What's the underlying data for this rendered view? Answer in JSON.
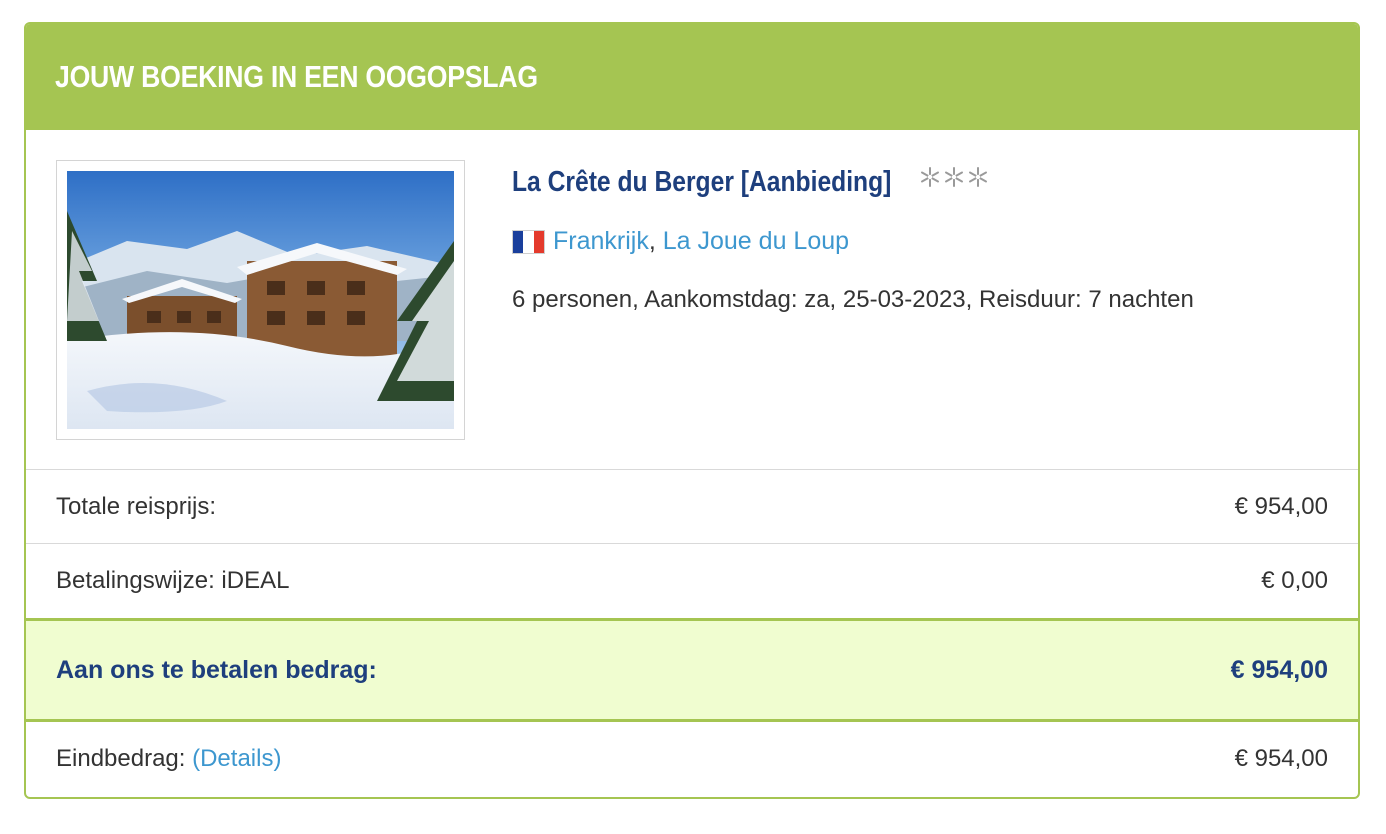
{
  "header": {
    "title": "JOUW BOEKING IN EEN OOGOPSLAG"
  },
  "accommodation": {
    "name": "La Crête du Berger [Aanbieding]",
    "star_count": 3,
    "country": "Frankrijk",
    "separator": ",",
    "place": "La Joue du Loup",
    "details": "6 personen, Aankomstdag: za, 25-03-2023, Reisduur: 7 nachten",
    "flag_colors": [
      "#1a3f9c",
      "#ffffff",
      "#e43a2c"
    ],
    "photo_icon": "snowy-chalet-photo"
  },
  "rows": {
    "total": {
      "label": "Totale reisprijs:",
      "value": "€ 954,00"
    },
    "payment": {
      "label": "Betalingswijze: iDEAL",
      "value": "€ 0,00"
    },
    "due": {
      "label": "Aan ons te betalen bedrag:",
      "value": "€ 954,00"
    },
    "final": {
      "label": "Eindbedrag:",
      "link": "(Details)",
      "value": "€ 954,00"
    }
  },
  "colors": {
    "accent": "#a5c552",
    "highlight_bg": "#f0fdd0",
    "title_blue": "#1e3f7d",
    "link_blue": "#3d97cf"
  }
}
